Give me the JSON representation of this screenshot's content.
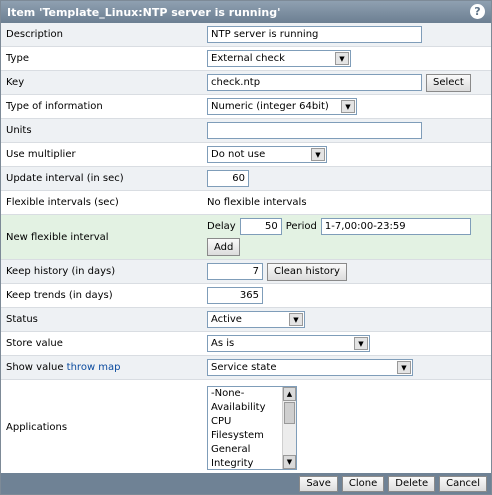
{
  "window": {
    "title": "Item 'Template_Linux:NTP server is running'",
    "help": "?"
  },
  "fields": {
    "description": {
      "label": "Description",
      "value": "NTP server is running"
    },
    "type": {
      "label": "Type",
      "value": "External check"
    },
    "key": {
      "label": "Key",
      "value": "check.ntp",
      "button": "Select"
    },
    "type_of_information": {
      "label": "Type of information",
      "value": "Numeric (integer 64bit)"
    },
    "units": {
      "label": "Units",
      "value": ""
    },
    "use_multiplier": {
      "label": "Use multiplier",
      "value": "Do not use"
    },
    "update_interval": {
      "label": "Update interval (in sec)",
      "value": "60"
    },
    "flexible_intervals": {
      "label": "Flexible intervals (sec)",
      "value": "No flexible intervals"
    },
    "new_flexible_interval": {
      "label": "New flexible interval",
      "delay_label": "Delay",
      "delay_value": "50",
      "period_label": "Period",
      "period_value": "1-7,00:00-23:59",
      "add_button": "Add"
    },
    "keep_history": {
      "label": "Keep history (in days)",
      "value": "7",
      "button": "Clean history"
    },
    "keep_trends": {
      "label": "Keep trends (in days)",
      "value": "365"
    },
    "status": {
      "label": "Status",
      "value": "Active"
    },
    "store_value": {
      "label": "Store value",
      "value": "As is"
    },
    "show_value": {
      "label": "Show value",
      "link": "throw map",
      "value": "Service state"
    },
    "applications": {
      "label": "Applications",
      "options": [
        "-None-",
        "Availability",
        "CPU",
        "Filesystem",
        "General",
        "Integrity"
      ]
    }
  },
  "footer": {
    "save": "Save",
    "clone": "Clone",
    "delete": "Delete",
    "cancel": "Cancel"
  }
}
